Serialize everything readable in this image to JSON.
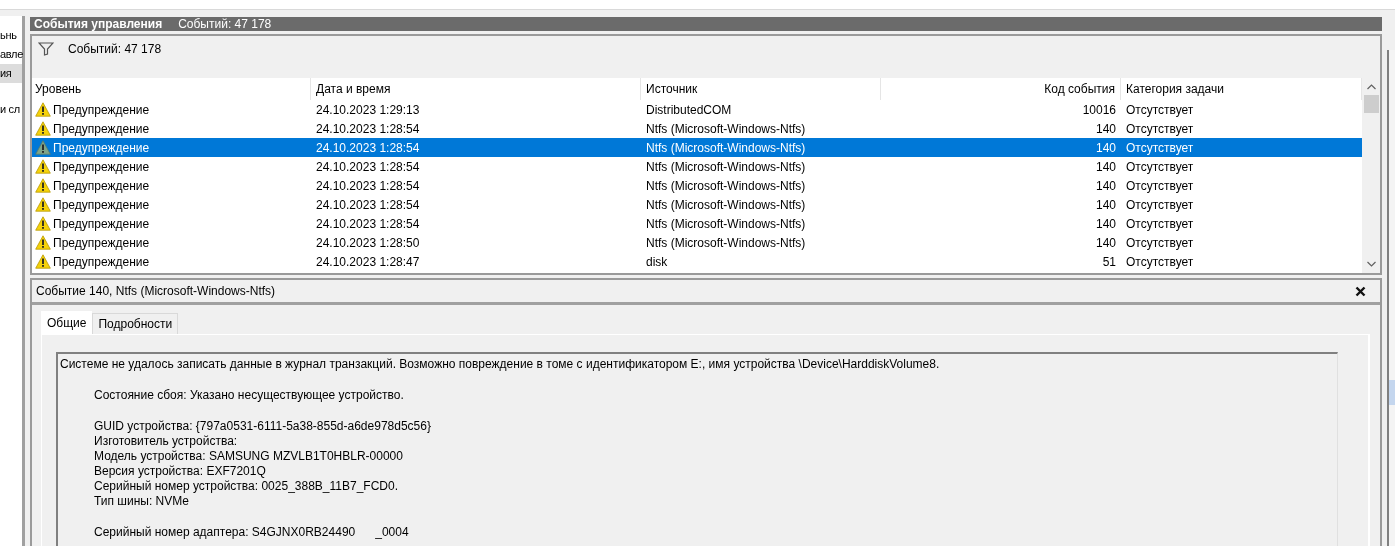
{
  "sidebar": {
    "items": [
      {
        "label": "ьнь",
        "selected": false
      },
      {
        "label": "авле",
        "selected": false
      },
      {
        "label": "ия",
        "selected": true
      },
      {
        "label": "и сл",
        "selected": false
      }
    ]
  },
  "header": {
    "title": "События управления",
    "count": "Событий: 47 178"
  },
  "filter_bar": {
    "count": "Событий: 47 178"
  },
  "table": {
    "columns": [
      "Уровень",
      "Дата и время",
      "Источник",
      "Код события",
      "Категория задачи"
    ],
    "rows": [
      {
        "level": "Предупреждение",
        "date": "24.10.2023 1:29:13",
        "source": "DistributedCOM",
        "code": "10016",
        "category": "Отсутствует",
        "selected": false
      },
      {
        "level": "Предупреждение",
        "date": "24.10.2023 1:28:54",
        "source": "Ntfs (Microsoft-Windows-Ntfs)",
        "code": "140",
        "category": "Отсутствует",
        "selected": false
      },
      {
        "level": "Предупреждение",
        "date": "24.10.2023 1:28:54",
        "source": "Ntfs (Microsoft-Windows-Ntfs)",
        "code": "140",
        "category": "Отсутствует",
        "selected": true
      },
      {
        "level": "Предупреждение",
        "date": "24.10.2023 1:28:54",
        "source": "Ntfs (Microsoft-Windows-Ntfs)",
        "code": "140",
        "category": "Отсутствует",
        "selected": false
      },
      {
        "level": "Предупреждение",
        "date": "24.10.2023 1:28:54",
        "source": "Ntfs (Microsoft-Windows-Ntfs)",
        "code": "140",
        "category": "Отсутствует",
        "selected": false
      },
      {
        "level": "Предупреждение",
        "date": "24.10.2023 1:28:54",
        "source": "Ntfs (Microsoft-Windows-Ntfs)",
        "code": "140",
        "category": "Отсутствует",
        "selected": false
      },
      {
        "level": "Предупреждение",
        "date": "24.10.2023 1:28:54",
        "source": "Ntfs (Microsoft-Windows-Ntfs)",
        "code": "140",
        "category": "Отсутствует",
        "selected": false
      },
      {
        "level": "Предупреждение",
        "date": "24.10.2023 1:28:50",
        "source": "Ntfs (Microsoft-Windows-Ntfs)",
        "code": "140",
        "category": "Отсутствует",
        "selected": false
      },
      {
        "level": "Предупреждение",
        "date": "24.10.2023 1:28:47",
        "source": "disk",
        "code": "51",
        "category": "Отсутствует",
        "selected": false
      }
    ]
  },
  "details": {
    "title": "Событие 140, Ntfs (Microsoft-Windows-Ntfs)",
    "tabs": [
      {
        "label": "Общие",
        "selected": true
      },
      {
        "label": "Подробности",
        "selected": false
      }
    ],
    "message": [
      {
        "indented": false,
        "lines": [
          "Системе не удалось записать данные в журнал транзакций. Возможно повреждение в томе с идентификатором E:, имя устройства \\Device\\HarddiskVolume8."
        ]
      },
      {
        "indented": true,
        "lines": [
          "Состояние сбоя: Указано несуществующее устройство."
        ]
      },
      {
        "indented": true,
        "lines": [
          "GUID устройства: {797a0531-6111-5a38-855d-a6de978d5c56}",
          "Изготовитель устройства:",
          "Модель устройства: SAMSUNG MZVLB1T0HBLR-00000",
          "Версия устройства: EXF7201Q",
          "Серийный номер устройства: 0025_388B_11B7_FCD0.",
          "Тип шины: NVMe"
        ]
      },
      {
        "indented": true,
        "lines": [
          "Серийный номер адаптера: S4GJNX0RB24490      _0004"
        ]
      }
    ]
  }
}
